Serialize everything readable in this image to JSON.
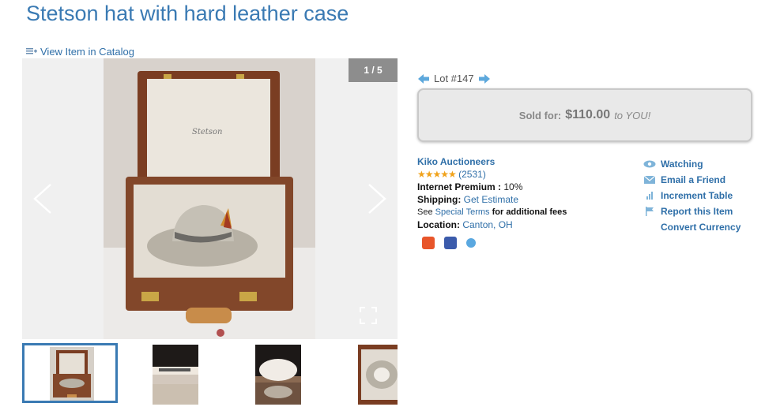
{
  "title": "Stetson hat with hard leather case",
  "catalog_link": "View Item in Catalog",
  "viewer": {
    "counter": "1 / 5",
    "case_brand": "Stetson"
  },
  "lot": {
    "label": "Lot #147"
  },
  "sold": {
    "label": "Sold for:",
    "price": "$110.00",
    "suffix": "to YOU!"
  },
  "seller": {
    "name": "Kiko Auctioneers",
    "rating_count": "(2531)",
    "premium_label": "Internet Premium :",
    "premium_value": "10%",
    "shipping_label": "Shipping:",
    "shipping_link": "Get Estimate",
    "terms_prefix": "See",
    "terms_link": "Special Terms",
    "terms_suffix": "for additional fees",
    "location_label": "Location:",
    "location_value": "Canton, OH"
  },
  "actions": [
    {
      "label": "Watching",
      "icon": "eye-icon"
    },
    {
      "label": "Email a Friend",
      "icon": "envelope-icon"
    },
    {
      "label": "Increment Table",
      "icon": "bar-chart-icon"
    },
    {
      "label": "Report this Item",
      "icon": "flag-icon"
    },
    {
      "label": "Convert Currency",
      "icon": ""
    }
  ],
  "colors": {
    "link": "#2f6fa8",
    "title": "#3a7ab3",
    "star": "#f0a21a",
    "active_thumb_border": "#3a7ab3"
  }
}
